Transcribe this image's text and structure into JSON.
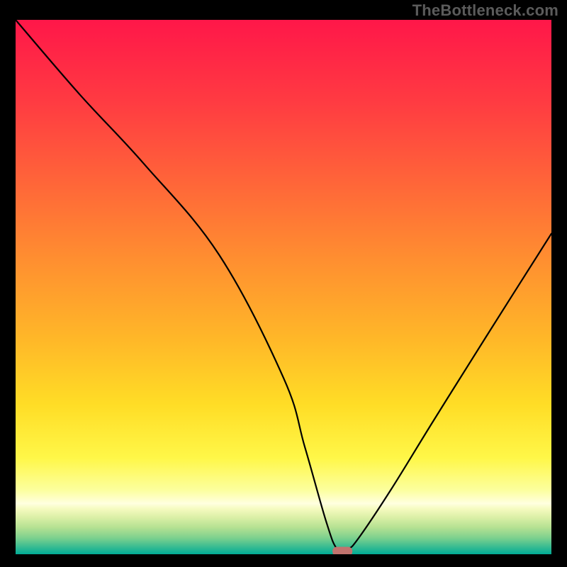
{
  "watermark": "TheBottleneck.com",
  "chart_data": {
    "type": "line",
    "title": "",
    "xlabel": "",
    "ylabel": "",
    "xlim": [
      0,
      100
    ],
    "ylim": [
      0,
      100
    ],
    "grid": false,
    "legend": false,
    "series": [
      {
        "name": "bottleneck-curve",
        "x": [
          0,
          12,
          24,
          38,
          50,
          54,
          58,
          60,
          62,
          64,
          70,
          78,
          88,
          100
        ],
        "values": [
          100,
          86,
          73,
          56,
          33,
          20,
          6,
          1,
          1,
          3,
          12,
          25,
          41,
          60
        ]
      }
    ],
    "marker": {
      "x": 61,
      "y": 0.6,
      "color": "#c1736e"
    },
    "bottom_band": {
      "start_y": 0,
      "end_y": 8,
      "colors_top_to_bottom": [
        "#fdfec6",
        "#f3f9b8",
        "#e5f3ab",
        "#cfeb9e",
        "#b2e195",
        "#8dd590",
        "#61c790",
        "#31b892",
        "#01aa96"
      ]
    },
    "gradient_stops": [
      {
        "offset": 0.0,
        "color": "#ff1749"
      },
      {
        "offset": 0.15,
        "color": "#ff3a42"
      },
      {
        "offset": 0.3,
        "color": "#ff6439"
      },
      {
        "offset": 0.45,
        "color": "#ff8f30"
      },
      {
        "offset": 0.6,
        "color": "#ffb828"
      },
      {
        "offset": 0.72,
        "color": "#ffdd26"
      },
      {
        "offset": 0.82,
        "color": "#fff748"
      },
      {
        "offset": 0.88,
        "color": "#fcff9e"
      },
      {
        "offset": 0.905,
        "color": "#ffffe0"
      },
      {
        "offset": 0.915,
        "color": "#f5fbc0"
      },
      {
        "offset": 0.93,
        "color": "#ddf0a8"
      },
      {
        "offset": 0.95,
        "color": "#b5e192"
      },
      {
        "offset": 0.97,
        "color": "#7bd08e"
      },
      {
        "offset": 0.985,
        "color": "#3dbd91"
      },
      {
        "offset": 1.0,
        "color": "#00ab96"
      }
    ]
  }
}
